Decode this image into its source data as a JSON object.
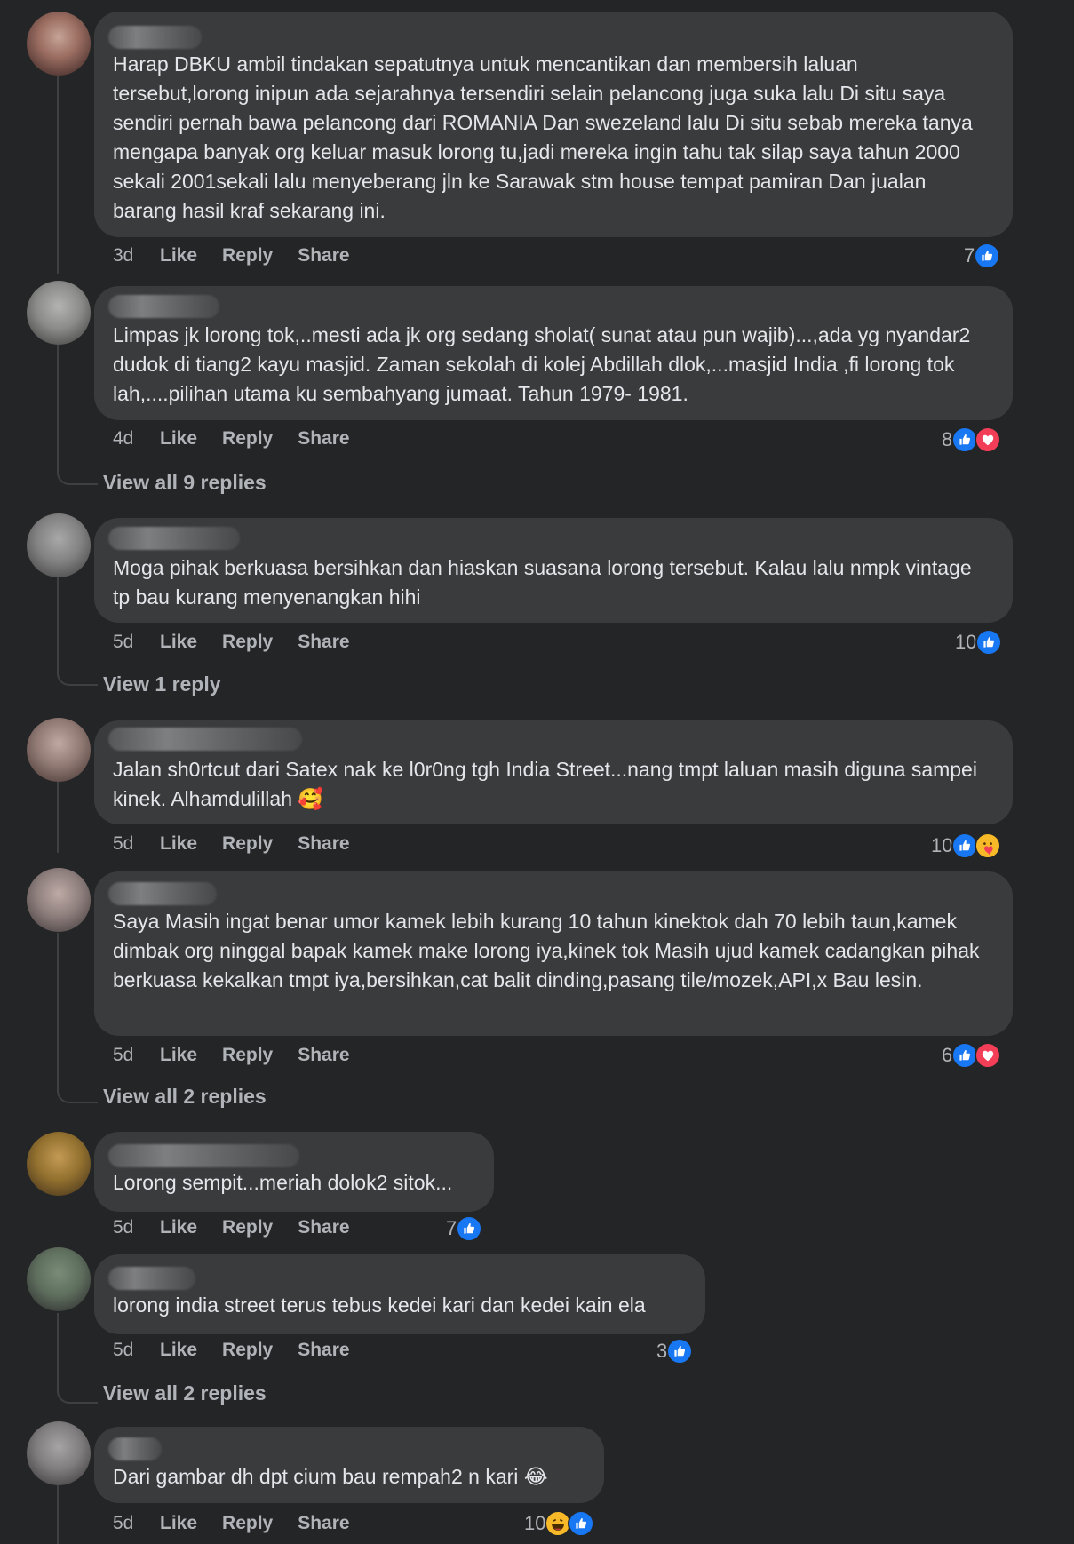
{
  "comments": [
    {
      "text": "Harap DBKU ambil tindakan sepatutnya untuk mencantikan dan membersih laluan tersebut,lorong inipun ada sejarahnya tersendiri selain pelancong juga suka lalu Di situ saya sendiri pernah bawa pelancong dari ROMANIA Dan swezeland lalu Di situ sebab mereka tanya mengapa banyak org keluar masuk lorong tu,jadi mereka ingin tahu tak silap saya tahun 2000 sekali 2001sekali lalu menyeberang jln ke Sarawak stm house tempat pamiran Dan jualan barang hasil kraf sekarang ini.",
      "time": "3d",
      "like": "Like",
      "reply": "Reply",
      "share": "Share",
      "reaction_count": "7",
      "reactions": [
        "like"
      ]
    },
    {
      "text": "Limpas jk lorong tok,..mesti ada jk org sedang sholat( sunat atau pun wajib)...,ada yg nyandar2 dudok di tiang2 kayu masjid. Zaman sekolah di kolej Abdillah dlok,...masjid India ,fi lorong tok lah,....pilihan utama ku sembahyang jumaat. Tahun 1979- 1981.",
      "time": "4d",
      "like": "Like",
      "reply": "Reply",
      "share": "Share",
      "reaction_count": "8",
      "reactions": [
        "like",
        "love"
      ],
      "view_replies": "View all 9 replies"
    },
    {
      "text": "Moga pihak berkuasa bersihkan dan hiaskan suasana lorong tersebut. Kalau lalu nmpk vintage tp bau kurang menyenangkan hihi",
      "time": "5d",
      "like": "Like",
      "reply": "Reply",
      "share": "Share",
      "reaction_count": "10",
      "reactions": [
        "like"
      ],
      "view_replies": "View 1 reply"
    },
    {
      "text": "Jalan sh0rtcut dari Satex nak ke l0r0ng tgh India Street...nang tmpt laluan masih diguna sampei kinek. Alhamdulillah 🥰",
      "time": "5d",
      "like": "Like",
      "reply": "Reply",
      "share": "Share",
      "reaction_count": "10",
      "reactions": [
        "like",
        "care"
      ]
    },
    {
      "text": "Saya Masih ingat benar umor kamek lebih kurang 10 tahun kinektok dah 70 lebih taun,kamek dimbak org ninggal bapak kamek make lorong iya,kinek tok Masih ujud kamek cadangkan pihak berkuasa kekalkan tmpt iya,bersihkan,cat balit dinding,pasang tile/mozek,API,x Bau lesin.",
      "time": "5d",
      "like": "Like",
      "reply": "Reply",
      "share": "Share",
      "reaction_count": "6",
      "reactions": [
        "like",
        "love"
      ],
      "view_replies": "View all 2 replies"
    },
    {
      "text": "Lorong sempit...meriah dolok2 sitok...",
      "time": "5d",
      "like": "Like",
      "reply": "Reply",
      "share": "Share",
      "reaction_count": "7",
      "reactions": [
        "like"
      ]
    },
    {
      "text": "lorong india street terus tebus kedei kari dan kedei kain ela",
      "time": "5d",
      "like": "Like",
      "reply": "Reply",
      "share": "Share",
      "reaction_count": "3",
      "reactions": [
        "like"
      ],
      "view_replies": "View all 2 replies"
    },
    {
      "text": "Dari gambar dh dpt cium bau rempah2 n kari 😂",
      "time": "5d",
      "like": "Like",
      "reply": "Reply",
      "share": "Share",
      "reaction_count": "10",
      "reactions": [
        "haha",
        "like"
      ]
    }
  ],
  "colors": {
    "background": "#242526",
    "bubble": "#3a3b3c",
    "text": "#e4e6eb",
    "secondary_text": "#b0b3b8",
    "like_blue": "#1877f2",
    "love_red": "#f33e58",
    "haha_yellow": "#f7b928"
  }
}
